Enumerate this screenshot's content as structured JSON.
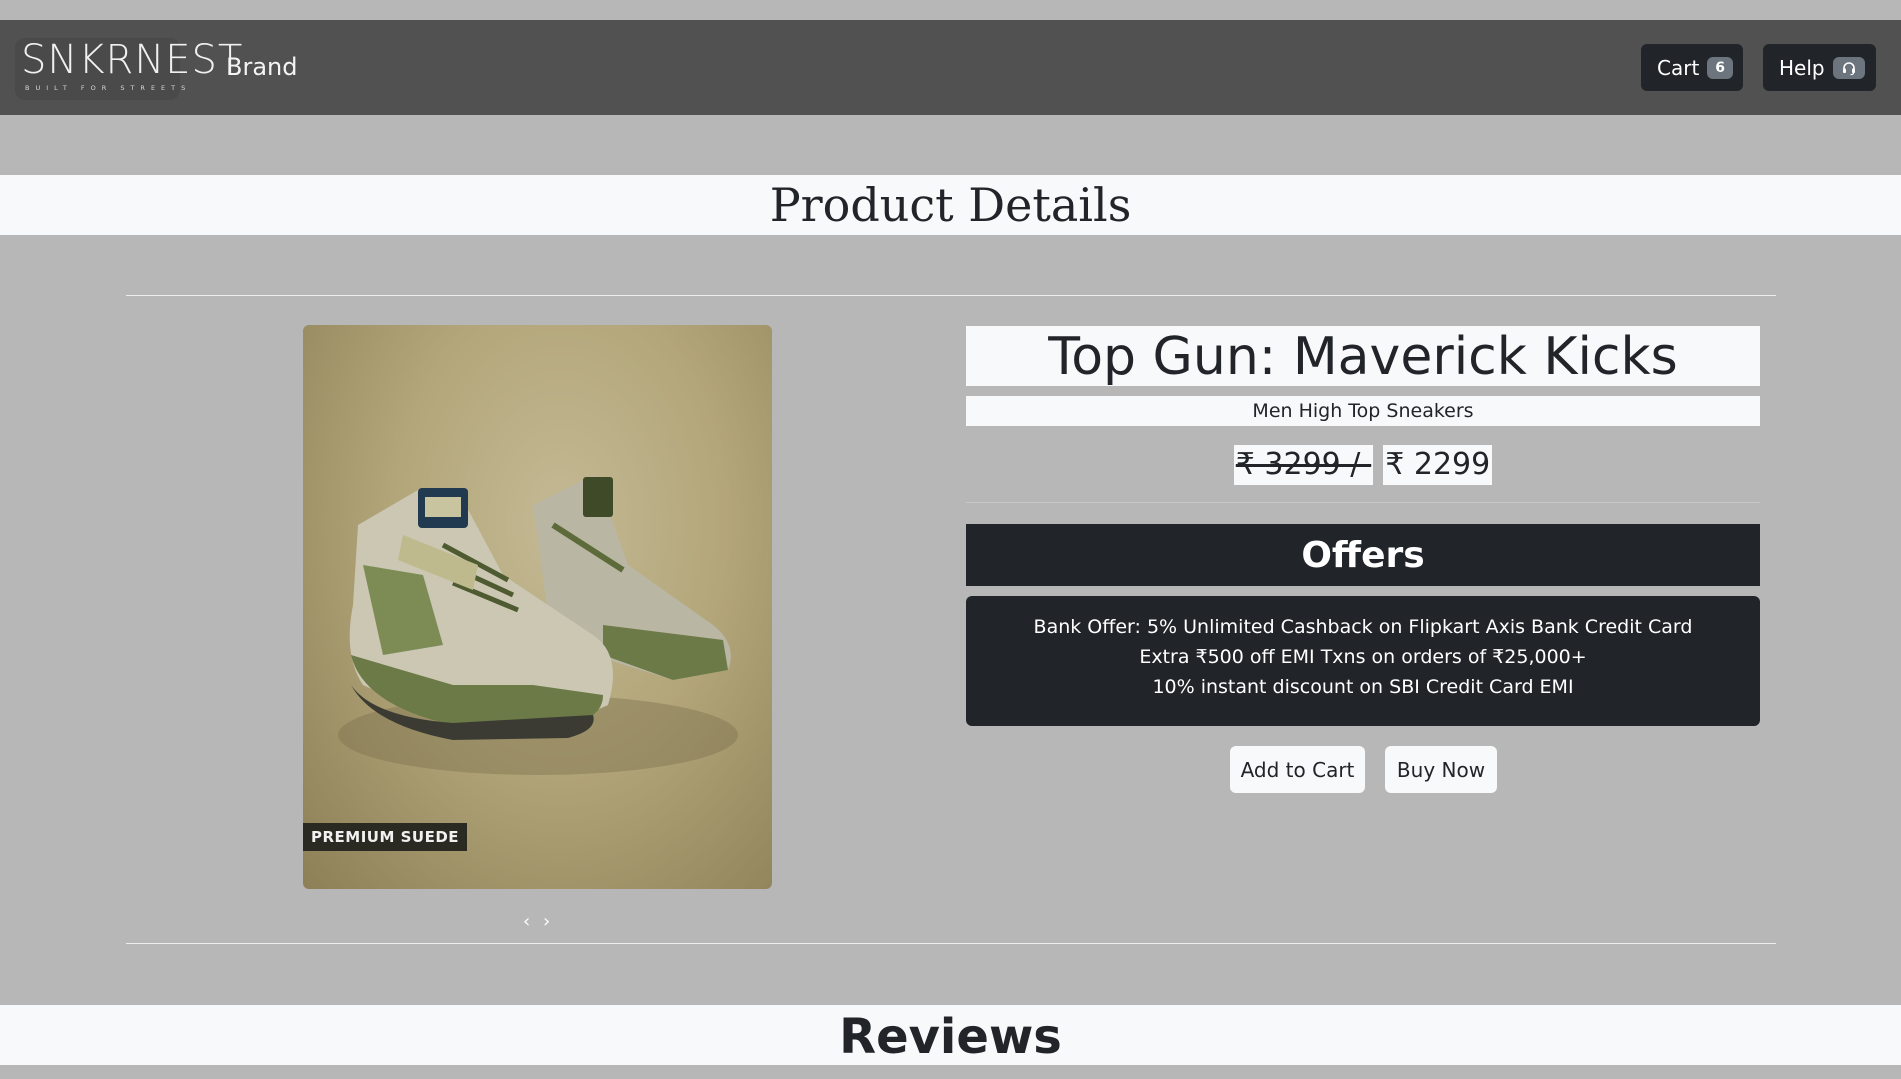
{
  "navbar": {
    "logo_text": "SNKRNEST",
    "logo_tagline": "BUILT FOR STREETS",
    "brand": "Brand",
    "cart_label": "Cart",
    "cart_count": "6",
    "help_label": "Help",
    "help_icon": "headset-icon"
  },
  "page": {
    "title": "Product Details",
    "reviews_title": "Reviews"
  },
  "product": {
    "image_badge": "PREMIUM SUEDE",
    "prev_control": "‹",
    "next_control": "›",
    "name": "Top Gun: Maverick Kicks",
    "subtitle": "Men High Top Sneakers",
    "old_price": "₹ 3299 /-",
    "price": "₹ 2299"
  },
  "offers": {
    "title": "Offers",
    "items": [
      "Bank Offer: 5% Unlimited Cashback on Flipkart Axis Bank Credit Card",
      "Extra ₹500 off EMI Txns on orders of ₹25,000+",
      "10% instant discount on SBI Credit Card EMI"
    ]
  },
  "actions": {
    "add_to_cart": "Add to Cart",
    "buy_now": "Buy Now"
  },
  "colors": {
    "navbar": "#515151",
    "page_bg": "#b7b7b7",
    "panel_light": "#f8f9fa",
    "panel_dark": "#212529"
  }
}
